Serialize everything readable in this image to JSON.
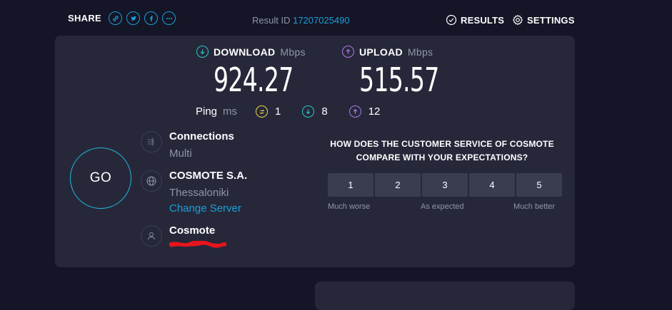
{
  "header": {
    "share_label": "SHARE",
    "share_icons": [
      "link-icon",
      "twitter-icon",
      "facebook-icon",
      "more-icon"
    ],
    "result_label": "Result ID",
    "result_id": "17207025490",
    "results_label": "RESULTS",
    "settings_label": "SETTINGS"
  },
  "download": {
    "label": "DOWNLOAD",
    "unit": "Mbps",
    "value": "924.27",
    "color": "#2bc3c6"
  },
  "upload": {
    "label": "UPLOAD",
    "unit": "Mbps",
    "value": "515.57",
    "color": "#b07ae6"
  },
  "ping": {
    "label": "Ping",
    "unit": "ms",
    "idle": "1",
    "download": "8",
    "upload": "12",
    "idle_color": "#f2d34b"
  },
  "go_label": "GO",
  "connections": {
    "title": "Connections",
    "value": "Multi"
  },
  "server": {
    "title": "COSMOTE S.A.",
    "location": "Thessaloniki",
    "change_label": "Change Server"
  },
  "provider": {
    "title": "Cosmote"
  },
  "survey": {
    "question": "HOW DOES THE CUSTOMER SERVICE OF COSMOTE COMPARE WITH YOUR EXPECTATIONS?",
    "options": [
      "1",
      "2",
      "3",
      "4",
      "5"
    ],
    "low": "Much worse",
    "mid": "As expected",
    "high": "Much better"
  },
  "colors": {
    "accent": "#1c9fd8",
    "card": "#26283a",
    "background": "#141526"
  }
}
